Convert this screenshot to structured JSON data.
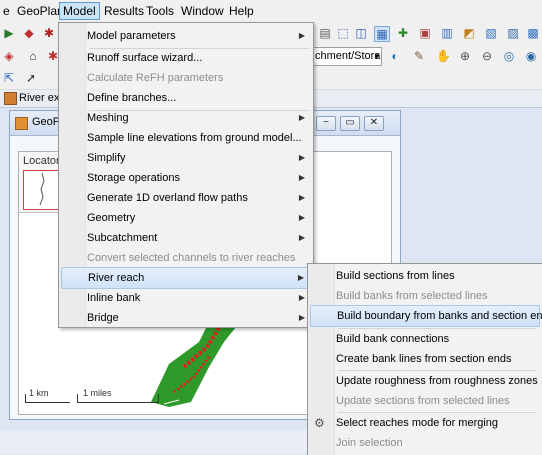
{
  "menubar": {
    "items": [
      {
        "label": "e",
        "name": "menu-edit-partial"
      },
      {
        "label": "GeoPlan",
        "name": "menu-geoplan"
      },
      {
        "label": "Model",
        "name": "menu-model"
      },
      {
        "label": "Results",
        "name": "menu-results"
      },
      {
        "label": "Tools",
        "name": "menu-tools"
      },
      {
        "label": "Window",
        "name": "menu-window"
      },
      {
        "label": "Help",
        "name": "menu-help"
      }
    ]
  },
  "toolbar": {
    "layer_combo_value": "chment/Storag",
    "combo_arrow": "▾"
  },
  "doc_tab": {
    "label": "River exar"
  },
  "child_window": {
    "title": "GeoP",
    "locator_label": "Locator",
    "scale_km": "1 km",
    "scale_miles": "1 miles",
    "btn_minimize": "−",
    "btn_restore": "▭",
    "btn_close": "✕"
  },
  "model_menu": {
    "items": [
      {
        "label": "Model parameters",
        "submenu": true,
        "disabled": false
      },
      {
        "label": "Runoff surface wizard...",
        "submenu": false,
        "disabled": false
      },
      {
        "label": "Calculate ReFH parameters",
        "submenu": false,
        "disabled": true
      },
      {
        "label": "Define branches...",
        "submenu": false,
        "disabled": false
      },
      {
        "label": "Meshing",
        "submenu": true,
        "disabled": false
      },
      {
        "label": "Sample line elevations from ground model...",
        "submenu": false,
        "disabled": false
      },
      {
        "label": "Simplify",
        "submenu": true,
        "disabled": false
      },
      {
        "label": "Storage operations",
        "submenu": true,
        "disabled": false
      },
      {
        "label": "Generate 1D overland flow paths",
        "submenu": true,
        "disabled": false
      },
      {
        "label": "Geometry",
        "submenu": true,
        "disabled": false
      },
      {
        "label": "Subcatchment",
        "submenu": true,
        "disabled": false
      },
      {
        "label": "Convert selected channels to river reaches",
        "submenu": false,
        "disabled": true
      },
      {
        "label": "River reach",
        "submenu": true,
        "disabled": false,
        "highlighted": true
      },
      {
        "label": "Inline bank",
        "submenu": true,
        "disabled": false
      },
      {
        "label": "Bridge",
        "submenu": true,
        "disabled": false
      }
    ]
  },
  "river_reach_submenu": {
    "items": [
      {
        "label": "Build sections from lines",
        "disabled": false
      },
      {
        "label": "Build banks from selected lines",
        "disabled": true
      },
      {
        "label": "Build boundary from banks and section ends",
        "disabled": false,
        "highlighted": true
      },
      {
        "label": "Build bank connections",
        "disabled": false
      },
      {
        "label": "Create bank lines from section ends",
        "disabled": false
      },
      {
        "label": "Update roughness from roughness zones",
        "disabled": false
      },
      {
        "label": "Update sections from selected lines",
        "disabled": true
      },
      {
        "label": "Select reaches mode for merging",
        "disabled": false,
        "icon": "merge-reaches-icon"
      },
      {
        "label": "Join selection",
        "disabled": true
      }
    ]
  },
  "colors": {
    "highlight": "#cfe2f7",
    "map_green": "#2f9a2a",
    "map_red": "#e02020"
  }
}
